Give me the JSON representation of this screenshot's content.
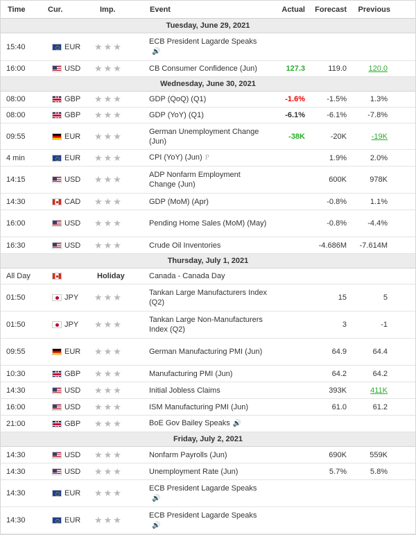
{
  "header": {
    "time": "Time",
    "cur": "Cur.",
    "imp": "Imp.",
    "event": "Event",
    "actual": "Actual",
    "forecast": "Forecast",
    "previous": "Previous"
  },
  "stars": "★★★",
  "speaker_icon": "🔊",
  "prelim_icon": "P",
  "days": [
    {
      "label": "Tuesday, June 29, 2021",
      "rows": [
        {
          "time": "15:40",
          "cur": "EUR",
          "flag": "eur",
          "event": "ECB President Lagarde Speaks",
          "speaker": true,
          "actual": "",
          "forecast": "",
          "previous": "",
          "h": 40
        },
        {
          "time": "16:00",
          "cur": "USD",
          "flag": "usd",
          "event": "CB Consumer Confidence (Jun)",
          "actual": "127.3",
          "actual_color": "green",
          "forecast": "119.0",
          "previous": "120.0",
          "prev_style": "green-ul",
          "h": 23
        }
      ]
    },
    {
      "label": "Wednesday, June 30, 2021",
      "rows": [
        {
          "time": "08:00",
          "cur": "GBP",
          "flag": "gbp",
          "event": "GDP (QoQ) (Q1)",
          "actual": "-1.6%",
          "actual_color": "red",
          "forecast": "-1.5%",
          "previous": "1.3%",
          "h": 23
        },
        {
          "time": "08:00",
          "cur": "GBP",
          "flag": "gbp",
          "event": "GDP (YoY) (Q1)",
          "actual": "-6.1%",
          "actual_color": "black",
          "forecast": "-6.1%",
          "previous": "-7.8%",
          "h": 23
        },
        {
          "time": "09:55",
          "cur": "EUR",
          "flag": "de",
          "event": "German Unemployment Change (Jun)",
          "actual": "-38K",
          "actual_color": "green",
          "forecast": "-20K",
          "previous": "-19K",
          "prev_style": "green-ul",
          "h": 38
        },
        {
          "time": "4 min",
          "cur": "EUR",
          "flag": "eur",
          "event": "CPI (YoY) (Jun)",
          "prelim": true,
          "actual": "",
          "forecast": "1.9%",
          "previous": "2.0%",
          "h": 24
        },
        {
          "time": "14:15",
          "cur": "USD",
          "flag": "usd",
          "event": "ADP Nonfarm Employment Change (Jun)",
          "actual": "",
          "forecast": "600K",
          "previous": "978K",
          "h": 39
        },
        {
          "time": "14:30",
          "cur": "CAD",
          "flag": "cad",
          "event": "GDP (MoM) (Apr)",
          "actual": "",
          "forecast": "-0.8%",
          "previous": "1.1%",
          "h": 24
        },
        {
          "time": "16:00",
          "cur": "USD",
          "flag": "usd",
          "event": "Pending Home Sales (MoM) (May)",
          "actual": "",
          "forecast": "-0.8%",
          "previous": "-4.4%",
          "h": 39
        },
        {
          "time": "16:30",
          "cur": "USD",
          "flag": "usd",
          "event": "Crude Oil Inventories",
          "actual": "",
          "forecast": "-4.686M",
          "previous": "-7.614M",
          "h": 24
        }
      ]
    },
    {
      "label": "Thursday, July 1, 2021",
      "rows": [
        {
          "time": "All Day",
          "cur": "",
          "flag": "cad",
          "holiday": "Holiday",
          "event": "Canada - Canada Day",
          "actual": "",
          "forecast": "",
          "previous": "",
          "h": 23
        },
        {
          "time": "01:50",
          "cur": "JPY",
          "flag": "jpy",
          "event": "Tankan Large Manufacturers Index (Q2)",
          "actual": "",
          "forecast": "15",
          "previous": "5",
          "h": 39
        },
        {
          "time": "01:50",
          "cur": "JPY",
          "flag": "jpy",
          "event": "Tankan Large Non-Manufacturers Index (Q2)",
          "actual": "",
          "forecast": "3",
          "previous": "-1",
          "h": 39
        },
        {
          "time": "09:55",
          "cur": "EUR",
          "flag": "de",
          "event": "German Manufacturing PMI (Jun)",
          "actual": "",
          "forecast": "64.9",
          "previous": "64.4",
          "h": 39
        },
        {
          "time": "10:30",
          "cur": "GBP",
          "flag": "gbp",
          "event": "Manufacturing PMI (Jun)",
          "actual": "",
          "forecast": "64.2",
          "previous": "64.2",
          "h": 24
        },
        {
          "time": "14:30",
          "cur": "USD",
          "flag": "usd",
          "event": "Initial Jobless Claims",
          "actual": "",
          "forecast": "393K",
          "previous": "411K",
          "prev_style": "green-ul",
          "h": 24
        },
        {
          "time": "16:00",
          "cur": "USD",
          "flag": "usd",
          "event": "ISM Manufacturing PMI (Jun)",
          "actual": "",
          "forecast": "61.0",
          "previous": "61.2",
          "h": 24
        },
        {
          "time": "21:00",
          "cur": "GBP",
          "flag": "gbp",
          "event": "BoE Gov Bailey Speaks",
          "speaker": true,
          "actual": "",
          "forecast": "",
          "previous": "",
          "h": 24
        }
      ]
    },
    {
      "label": "Friday, July 2, 2021",
      "rows": [
        {
          "time": "14:30",
          "cur": "USD",
          "flag": "usd",
          "event": "Nonfarm Payrolls (Jun)",
          "actual": "",
          "forecast": "690K",
          "previous": "559K",
          "h": 24
        },
        {
          "time": "14:30",
          "cur": "USD",
          "flag": "usd",
          "event": "Unemployment Rate (Jun)",
          "actual": "",
          "forecast": "5.7%",
          "previous": "5.8%",
          "h": 24
        },
        {
          "time": "14:30",
          "cur": "EUR",
          "flag": "eur",
          "event": "ECB President Lagarde Speaks",
          "speaker": true,
          "actual": "",
          "forecast": "",
          "previous": "",
          "h": 39
        },
        {
          "time": "14:30",
          "cur": "EUR",
          "flag": "eur",
          "event": "ECB President Lagarde Speaks",
          "speaker": true,
          "actual": "",
          "forecast": "",
          "previous": "",
          "h": 39
        }
      ]
    }
  ]
}
